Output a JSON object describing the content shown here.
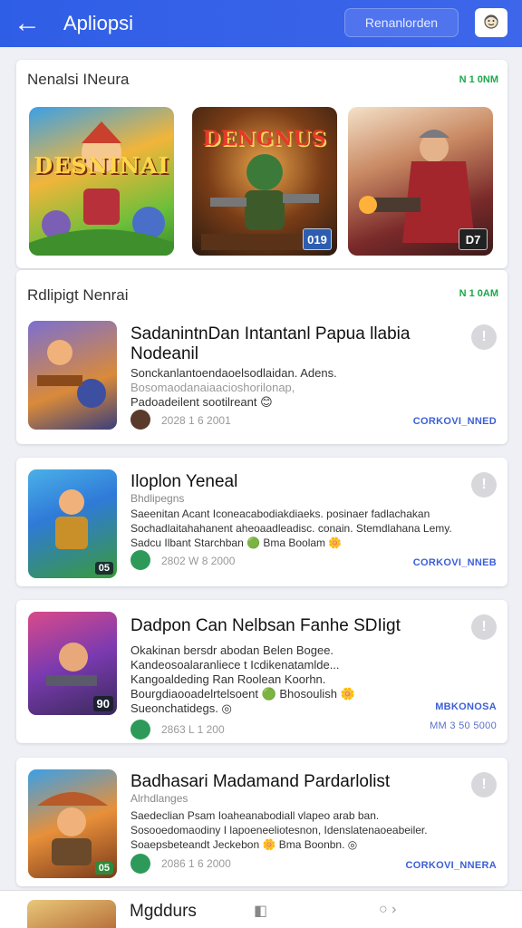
{
  "header": {
    "back_glyph": "←",
    "title": "Apliopsi",
    "action_label": "Renanlorden"
  },
  "featured": {
    "title": "Nenalsi INeura",
    "meta": "N 1 0NM",
    "tiles": [
      {
        "art_title": "DESNINAI",
        "badge": ""
      },
      {
        "art_title": "DENGNUS",
        "badge": "019"
      },
      {
        "art_title": "",
        "badge": "D7"
      }
    ]
  },
  "list": {
    "title": "Rdlipigt Nenrai",
    "meta": "N 1 0AM",
    "items": [
      {
        "title": "SadanintnDan Intantanl Papua llabia Nodeanil",
        "subtitle": "",
        "desc": [
          "Sonckanlantoendaoelsodlaidan. Adens.",
          "Bosomaodanaiaacioshorilonap,",
          "Padoadeilent sootilreant 😊"
        ],
        "date": "2028 1 6 2001",
        "link": "CORKOVI_NNED",
        "link2": "",
        "badge": ""
      },
      {
        "title": "Iloplon Yeneal",
        "subtitle": "Bhdlipegns",
        "desc": [
          "Saeenitan Acant Iconeacabodiakdiaeks. posinaer fadlachakan",
          "Sochadlaitahahanent aheoaadleadisc. conain. Stemdlahana Lemy.",
          "Sadcu Ilbant Starchban 🟢 Bma Boolam 🌼"
        ],
        "date": "2802 W 8 2000",
        "link": "CORKOVI_NNEB",
        "link2": "",
        "badge": "05"
      },
      {
        "title": "Dadpon Can Nelbsan Fanhe SDIigt",
        "subtitle": "",
        "desc": [
          "Okakinan bersdr abodan Belen Bogee.",
          "Kandeosoalaranliece t Icdikenatamlde...",
          "Kangoaldeding Ran Roolean Koorhn.",
          "Bourgdiaooadelrtelsoent 🟢 Bhosoulish 🌼",
          "Sueonchatidegs. ◎"
        ],
        "date": "2863 L 1 200",
        "link": "MBKONOSA",
        "link2": "MM 3 50 5000",
        "badge": "90"
      },
      {
        "title": "Badhasari Madamand Pardarlolist",
        "subtitle": "Alrhdlanges",
        "desc": [
          "Saedeclian Psam Ioaheanabodiall vlapeo arab ban.",
          "Sosooedomaodiny I lapoeneeliotesnon, Idenslatenaoeabeiler.",
          "Soaepsbeteandt Jeckebon 🌼 Bma Boonbn. ◎"
        ],
        "date": "2086 1 6 2000",
        "link": "CORKOVI_NNERA",
        "link2": "",
        "badge": "05"
      }
    ]
  },
  "bottom": {
    "title": "Mgddurs",
    "nav1": "◧",
    "nav2": "○ ›"
  },
  "colors": {
    "header": "#2f5ee6",
    "accent_green": "#1aa94a",
    "link_blue": "#3c5fd6"
  }
}
